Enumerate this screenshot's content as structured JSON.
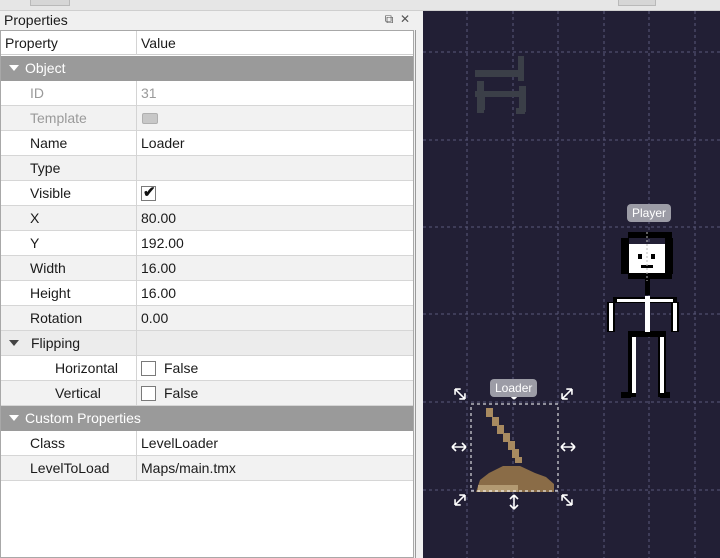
{
  "panel": {
    "title": "Properties",
    "columns": {
      "property": "Property",
      "value": "Value"
    },
    "groups": {
      "object": "Object",
      "flipping": "Flipping",
      "custom": "Custom Properties"
    },
    "object_rows": [
      {
        "key": "ID",
        "value": "31",
        "disabled": true
      },
      {
        "key": "Template",
        "value": "",
        "disabled": true,
        "icon": "template-icon"
      },
      {
        "key": "Name",
        "value": "Loader"
      },
      {
        "key": "Type",
        "value": ""
      },
      {
        "key": "Visible",
        "checkbox": true,
        "checked": true
      },
      {
        "key": "X",
        "value": "80.00"
      },
      {
        "key": "Y",
        "value": "192.00"
      },
      {
        "key": "Width",
        "value": "16.00"
      },
      {
        "key": "Height",
        "value": "16.00"
      },
      {
        "key": "Rotation",
        "value": "0.00"
      }
    ],
    "flipping_rows": [
      {
        "key": "Horizontal",
        "checkbox": true,
        "checked": false,
        "value": "False"
      },
      {
        "key": "Vertical",
        "checkbox": true,
        "checked": false,
        "value": "False"
      }
    ],
    "custom_rows": [
      {
        "key": "Class",
        "value": "LevelLoader"
      },
      {
        "key": "LevelToLoad",
        "value": "Maps/main.tmx"
      }
    ]
  },
  "canvas": {
    "objects": [
      {
        "label": "Player"
      },
      {
        "label": "Loader"
      }
    ],
    "colors": {
      "background": "#221f35",
      "grid": "#5a5a7a",
      "badge": "#9c9ca6"
    }
  }
}
